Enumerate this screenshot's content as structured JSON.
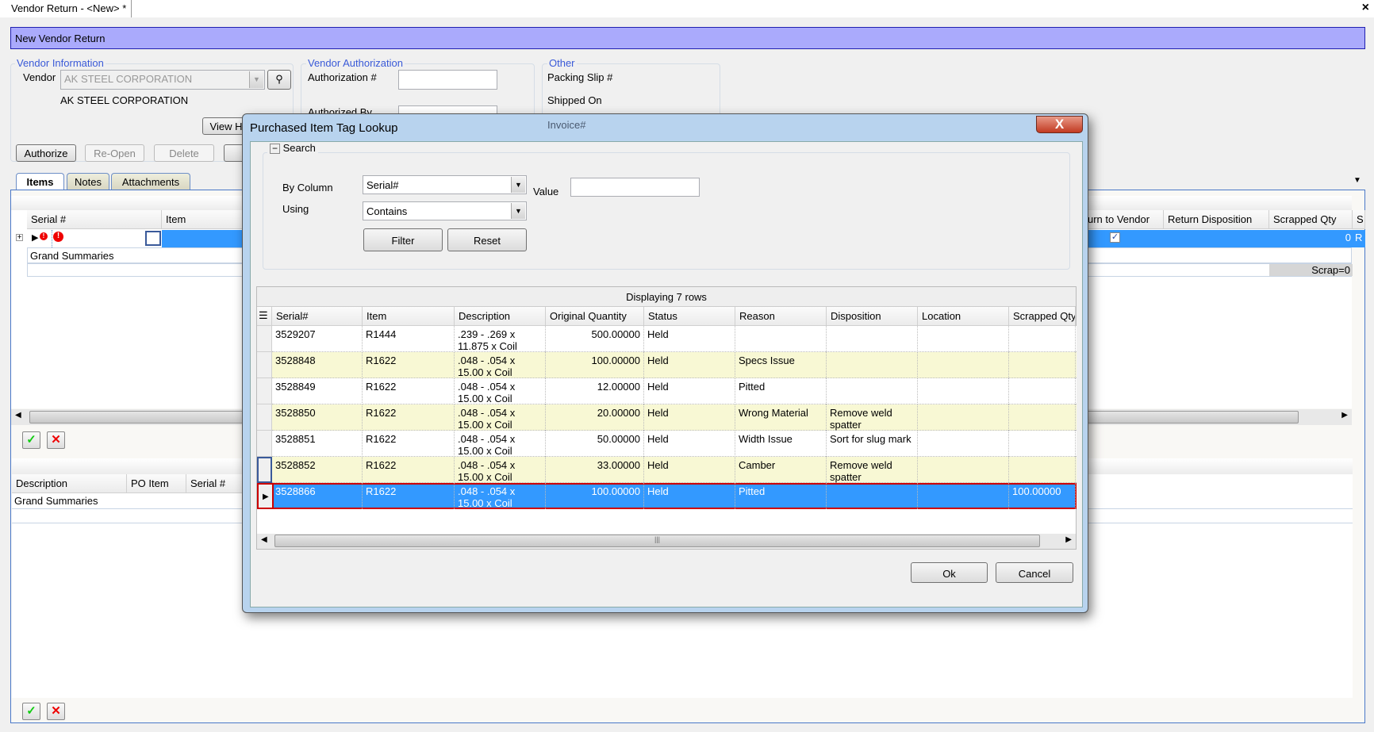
{
  "window": {
    "tab_title": "Vendor Return - <New> *",
    "close": "×"
  },
  "banner": {
    "title": "New Vendor Return"
  },
  "vendor_info": {
    "legend": "Vendor Information",
    "vendor_label": "Vendor",
    "vendor_value": "AK STEEL CORPORATION",
    "vendor_name": "AK STEEL CORPORATION",
    "view_button": "View H"
  },
  "vendor_auth": {
    "legend": "Vendor Authorization",
    "auth_label": "Authorization #",
    "auth_value": "",
    "authorized_by_label": "Authorized By"
  },
  "other": {
    "legend": "Other",
    "packing_slip_label": "Packing Slip #",
    "shipped_on_label": "Shipped On",
    "invoice_label": "Invoice#"
  },
  "actions": {
    "authorize": "Authorize",
    "reopen": "Re-Open",
    "delete": "Delete"
  },
  "tabs": [
    {
      "label": "Items",
      "active": true
    },
    {
      "label": "Notes"
    },
    {
      "label": "Attachments"
    }
  ],
  "items_grid": {
    "columns": {
      "serial": "Serial #",
      "item": "Item",
      "return_to_vendor": "urn to Vendor",
      "return_disposition": "Return Disposition",
      "scrapped_qty": "Scrapped Qty",
      "s": "S"
    },
    "row": {
      "serial": "",
      "return_to_vendor_checked": true,
      "scrapped_qty": "0",
      "s": "R"
    },
    "grand_summaries": "Grand Summaries",
    "scrap_summary": "Scrap=0"
  },
  "lower_grid": {
    "columns": {
      "description": "Description",
      "po_item": "PO Item",
      "serial": "Serial #"
    },
    "grand_summaries": "Grand Summaries"
  },
  "dialog": {
    "title": "Purchased Item Tag Lookup",
    "close": "X",
    "search": {
      "legend": "Search",
      "collapse": "−",
      "by_column_label": "By Column",
      "by_column_value": "Serial#",
      "value_label": "Value",
      "value": "",
      "using_label": "Using",
      "using_value": "Contains",
      "filter": "Filter",
      "reset": "Reset"
    },
    "grid": {
      "status": "Displaying 7 rows",
      "columns": [
        "Serial#",
        "Item",
        "Description",
        "Original Quantity",
        "Status",
        "Reason",
        "Disposition",
        "Location",
        "Scrapped Qty"
      ],
      "rows": [
        [
          "3529207",
          "R1444",
          ".239 - .269 x 11.875 x Coil",
          "500.00000",
          "Held",
          "",
          "",
          "",
          ""
        ],
        [
          "3528848",
          "R1622",
          ".048 - .054  x 15.00 x Coil",
          "100.00000",
          "Held",
          "Specs Issue",
          "",
          "",
          ""
        ],
        [
          "3528849",
          "R1622",
          ".048 - .054  x 15.00 x Coil",
          "12.00000",
          "Held",
          "Pitted",
          "",
          "",
          ""
        ],
        [
          "3528850",
          "R1622",
          ".048 - .054  x 15.00 x Coil",
          "20.00000",
          "Held",
          "Wrong Material",
          "Remove weld spatter",
          "",
          ""
        ],
        [
          "3528851",
          "R1622",
          ".048 - .054  x 15.00 x Coil",
          "50.00000",
          "Held",
          "Width Issue",
          "Sort for slug mark",
          "",
          ""
        ],
        [
          "3528852",
          "R1622",
          ".048 - .054  x 15.00 x Coil",
          "33.00000",
          "Held",
          "Camber",
          "Remove weld spatter",
          "",
          ""
        ],
        [
          "3528866",
          "R1622",
          ".048 - .054  x 15.00 x Coil",
          "100.00000",
          "Held",
          "Pitted",
          "",
          "",
          "100.00000"
        ]
      ],
      "selected_row": 6
    },
    "ok": "Ok",
    "cancel": "Cancel"
  },
  "colors": {
    "banner": "#aaaafc",
    "selection": "#3399ff",
    "alt_row": "#f8f8d4",
    "legend": "#3a5ad8"
  }
}
